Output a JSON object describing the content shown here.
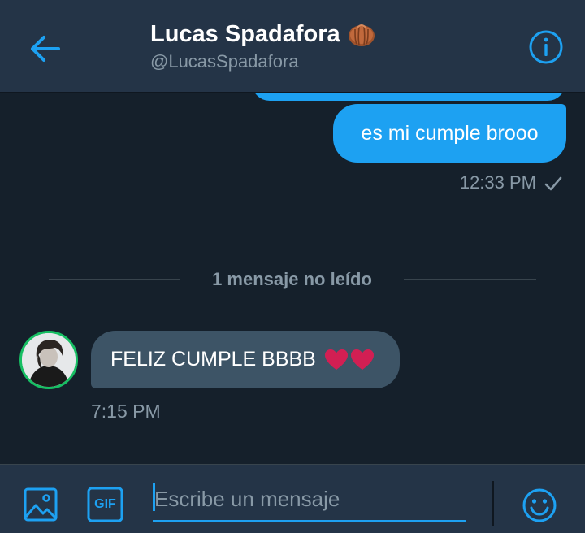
{
  "header": {
    "title": "Lucas Spadafora",
    "handle": "@LucasSpadafora",
    "title_emoji": "peanut-emoji",
    "back_icon": "arrow-left-icon",
    "info_icon": "info-icon"
  },
  "messages": {
    "outgoing": {
      "text": "es mi cumple brooo",
      "time": "12:33 PM",
      "status_icon": "checkmark-icon"
    },
    "unread_divider": "1 mensaje no leído",
    "incoming": {
      "text": "FELIZ CUMPLE BBBB",
      "emoji": "red-heart-emoji x2",
      "time": "7:15 PM"
    }
  },
  "composer": {
    "placeholder": "Escribe un mensaje",
    "value": "",
    "image_icon": "image-icon",
    "gif_label": "GIF",
    "emoji_icon": "smiley-icon"
  },
  "colors": {
    "background": "#15202b",
    "header": "#243447",
    "accent": "#1da1f2",
    "incoming_bubble": "#3d5466",
    "muted_text": "#8899a6",
    "avatar_ring": "#17bf63",
    "heart": "#e0245e"
  }
}
